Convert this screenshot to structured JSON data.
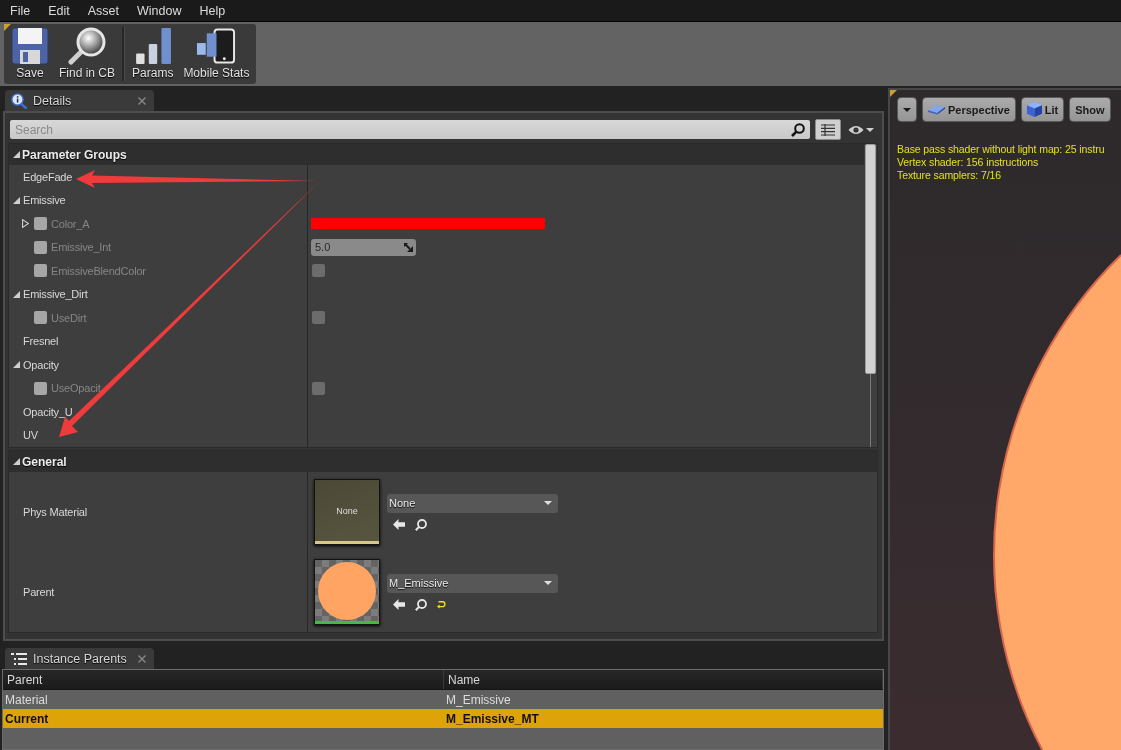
{
  "menu": [
    "File",
    "Edit",
    "Asset",
    "Window",
    "Help"
  ],
  "toolbar": [
    [
      {
        "kind": "save",
        "label": "Save"
      },
      {
        "kind": "find",
        "label": "Find in CB"
      }
    ],
    [
      {
        "kind": "params",
        "label": "Params"
      },
      {
        "kind": "stats",
        "label": "Mobile Stats"
      }
    ]
  ],
  "details_tab": {
    "title": "Details"
  },
  "search": {
    "placeholder": "Search"
  },
  "parameter_groups": {
    "title": "Parameter Groups",
    "expanded": true,
    "rows": [
      {
        "label": "EdgeFade"
      },
      {
        "label": "Emissive",
        "expanded": true,
        "children": [
          {
            "label": "Color_A",
            "kind": "color",
            "override": false,
            "expanded": false,
            "color": "#ff0000"
          },
          {
            "label": "Emissive_Int",
            "kind": "number",
            "override": false,
            "value": "5.0"
          },
          {
            "label": "EmissiveBlendColor",
            "kind": "bool",
            "override": false,
            "checked": false
          }
        ]
      },
      {
        "label": "Emissive_Dirt",
        "expanded": true,
        "children": [
          {
            "label": "UseDirt",
            "kind": "bool",
            "override": false,
            "checked": false
          }
        ]
      },
      {
        "label": "Fresnel"
      },
      {
        "label": "Opacity",
        "expanded": true,
        "children": [
          {
            "label": "UseOpacit",
            "kind": "bool",
            "override": false,
            "checked": false
          }
        ]
      },
      {
        "label": "Opacity_U"
      },
      {
        "label": "UV"
      }
    ]
  },
  "general": {
    "title": "General",
    "expanded": true,
    "rows": [
      {
        "label": "Phys Material",
        "thumbnail": {
          "kind": "empty",
          "text": "None",
          "color": "#d8c98a"
        },
        "value": "None",
        "actions": [
          {
            "kind": "browse"
          },
          {
            "kind": "find"
          }
        ]
      },
      {
        "label": "Parent",
        "thumbnail": {
          "kind": "sphere",
          "color": "#3cbf3c"
        },
        "value": "M_Emissive",
        "actions": [
          {
            "kind": "browse"
          },
          {
            "kind": "find"
          },
          {
            "kind": "reset"
          }
        ]
      }
    ]
  },
  "instance_parents": {
    "title": "Instance Parents",
    "columns": [
      "Parent",
      "Name"
    ],
    "rows": [
      {
        "parent": "Material",
        "name": "M_Emissive",
        "selected": false
      },
      {
        "parent": "Current",
        "name": "M_Emissive_MT",
        "selected": true
      }
    ]
  },
  "viewport": {
    "buttons": [
      {
        "kind": "menu"
      },
      {
        "kind": "perspective",
        "label": "Perspective"
      },
      {
        "kind": "lit",
        "label": "Lit"
      },
      {
        "kind": "show",
        "label": "Show"
      }
    ],
    "stats": [
      "Base pass shader without light map: 25 instru",
      "Vertex shader: 156 instructions",
      "Texture samplers: 7/16"
    ]
  }
}
